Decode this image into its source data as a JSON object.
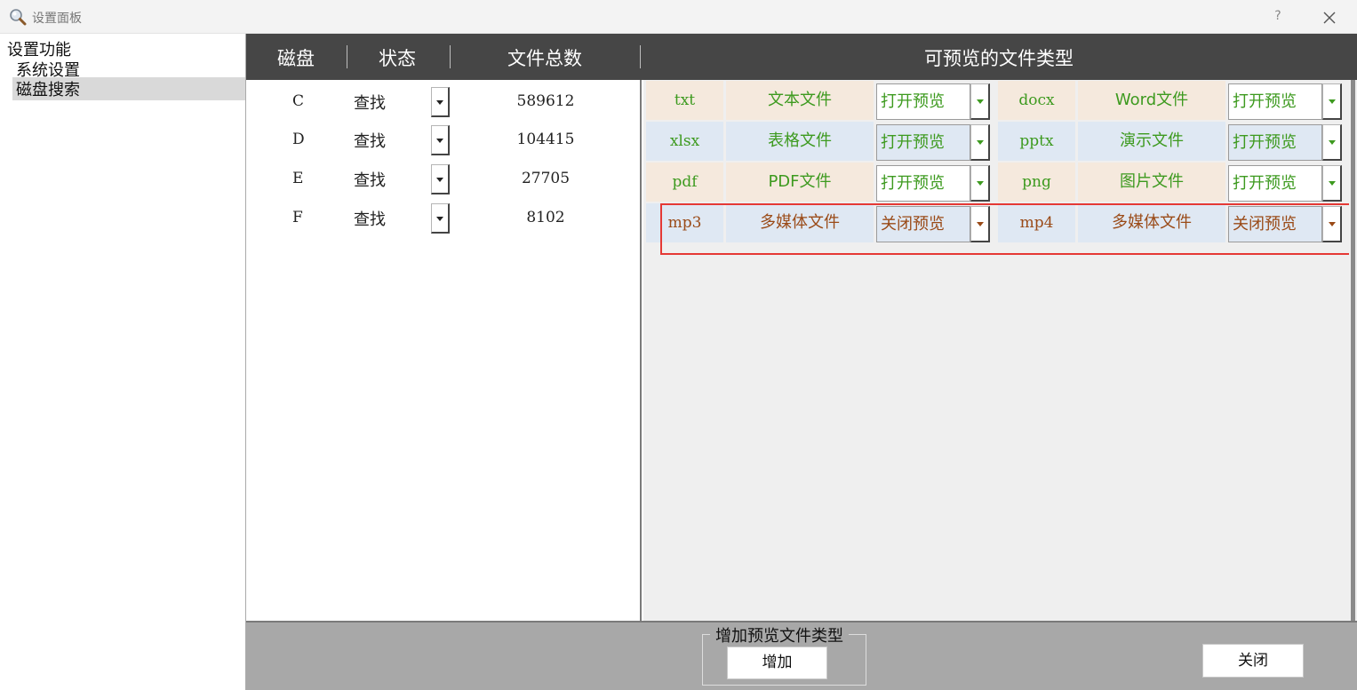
{
  "window": {
    "title": "设置面板",
    "help": "?"
  },
  "tree": {
    "root": "设置功能",
    "items": [
      {
        "label": "系统设置",
        "selected": false
      },
      {
        "label": "磁盘搜索",
        "selected": true
      }
    ]
  },
  "header": {
    "disk": "磁盘",
    "status": "状态",
    "count": "文件总数",
    "types": "可预览的文件类型"
  },
  "disks": [
    {
      "letter": "C",
      "status": "查找",
      "count": "589612"
    },
    {
      "letter": "D",
      "status": "查找",
      "count": "104415"
    },
    {
      "letter": "E",
      "status": "查找",
      "count": "27705"
    },
    {
      "letter": "F",
      "status": "查找",
      "count": "8102"
    }
  ],
  "file_types": [
    {
      "ext": "txt",
      "desc": "文本文件",
      "state": "打开预览",
      "theme": "orange"
    },
    {
      "ext": "docx",
      "desc": "Word文件",
      "state": "打开预览",
      "theme": "orange"
    },
    {
      "ext": "xlsx",
      "desc": "表格文件",
      "state": "打开预览",
      "theme": "blue"
    },
    {
      "ext": "pptx",
      "desc": "演示文件",
      "state": "打开预览",
      "theme": "blue"
    },
    {
      "ext": "pdf",
      "desc": "PDF文件",
      "state": "打开预览",
      "theme": "orange"
    },
    {
      "ext": "png",
      "desc": "图片文件",
      "state": "打开预览",
      "theme": "orange"
    },
    {
      "ext": "mp3",
      "desc": "多媒体文件",
      "state": "关闭预览",
      "theme": "blue"
    },
    {
      "ext": "mp4",
      "desc": "多媒体文件",
      "state": "关闭预览",
      "theme": "blue"
    }
  ],
  "footer": {
    "group_title": "增加预览文件类型",
    "add_label": "增加",
    "close_label": "关闭"
  },
  "colors": {
    "header_bg": "#464646",
    "row_orange": "#f5e9dd",
    "row_blue": "#dfe8f3",
    "text_open": "#3d9a1f",
    "text_closed": "#9a4a17",
    "highlight": "#e53935",
    "footer_bg": "#a8a8a8"
  },
  "icons": {
    "app": "magnifier-icon",
    "close": "close-icon",
    "dropdown": "dropdown-arrow-icon"
  }
}
